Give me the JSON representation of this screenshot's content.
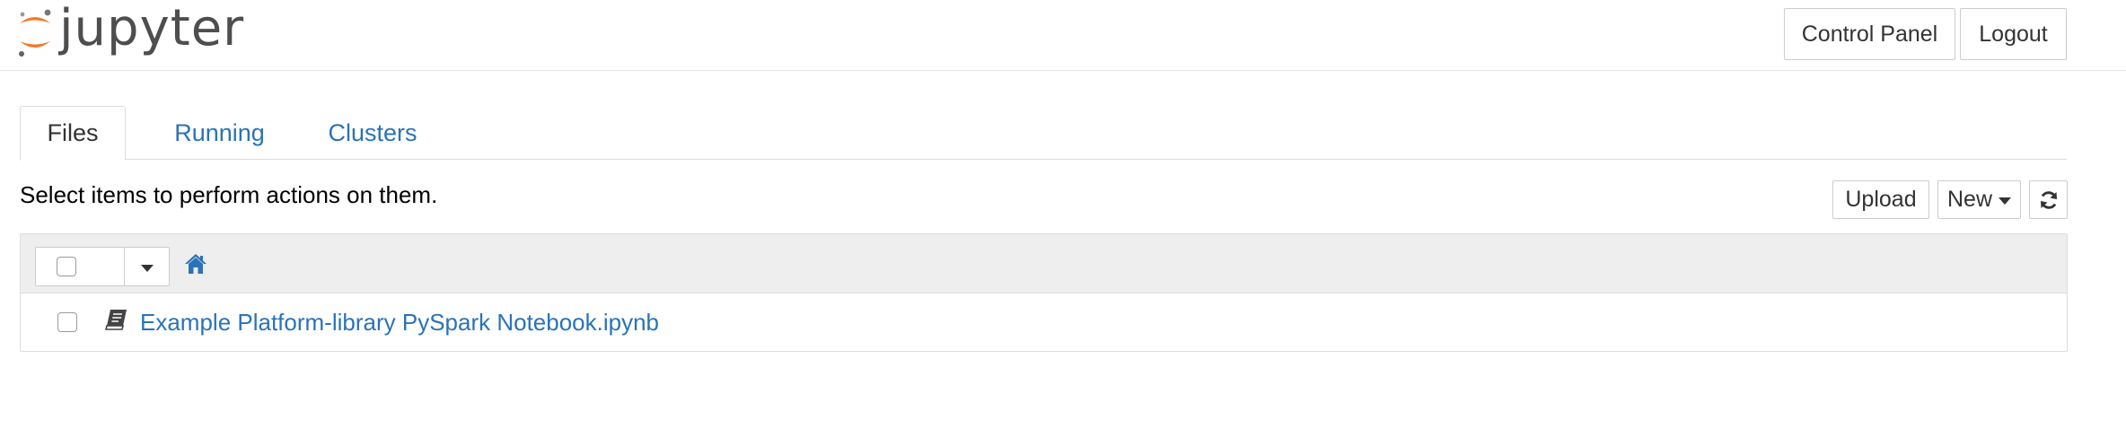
{
  "header": {
    "logo_text": "jupyter",
    "control_panel_label": "Control Panel",
    "logout_label": "Logout",
    "brand_orange": "#f37726",
    "logo_text_color": "#4e4e4e"
  },
  "tabs": [
    {
      "label": "Files",
      "active": true
    },
    {
      "label": "Running",
      "active": false
    },
    {
      "label": "Clusters",
      "active": false
    }
  ],
  "toolbar": {
    "instructions": "Select items to perform actions on them.",
    "upload_label": "Upload",
    "new_label": "New",
    "refresh_icon": "refresh-icon"
  },
  "listing": {
    "header": {
      "select_all_checked": false,
      "breadcrumb_icon": "home-icon"
    },
    "items": [
      {
        "name": "Example Platform-library PySpark Notebook.ipynb",
        "icon": "notebook-icon",
        "checked": false
      }
    ]
  },
  "colors": {
    "link": "#2a73b8",
    "border": "#dddddd",
    "header_bg": "#eeeeee"
  }
}
